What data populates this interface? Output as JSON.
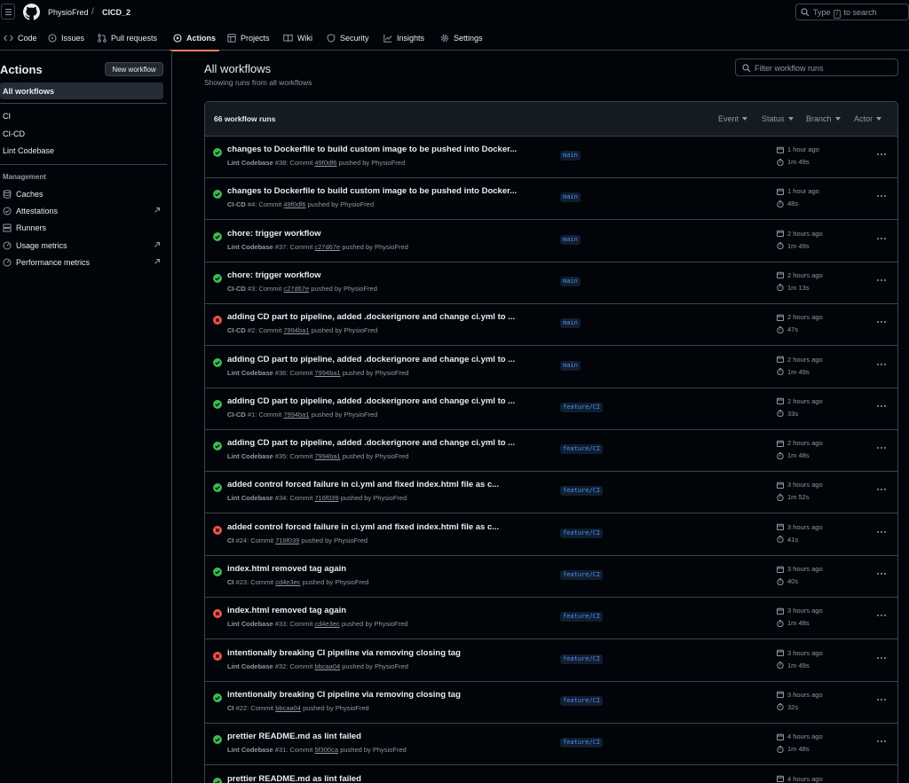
{
  "header": {
    "owner": "PhysioFred",
    "separator": "/",
    "repo": "CICD_2",
    "search": {
      "prefix": "Type",
      "key": "/",
      "suffix": "to search"
    }
  },
  "tabs": [
    {
      "label": "Code",
      "icon": "code-icon",
      "active": false
    },
    {
      "label": "Issues",
      "icon": "issue-icon",
      "active": false
    },
    {
      "label": "Pull requests",
      "icon": "pull-request-icon",
      "active": false
    },
    {
      "label": "Actions",
      "icon": "play-icon",
      "active": true
    },
    {
      "label": "Projects",
      "icon": "table-icon",
      "active": false
    },
    {
      "label": "Wiki",
      "icon": "book-icon",
      "active": false
    },
    {
      "label": "Security",
      "icon": "shield-icon",
      "active": false
    },
    {
      "label": "Insights",
      "icon": "graph-icon",
      "active": false
    },
    {
      "label": "Settings",
      "icon": "gear-icon",
      "active": false
    }
  ],
  "sidebar": {
    "title": "Actions",
    "new_workflow": "New workflow",
    "all_workflows": "All workflows",
    "workflows": [
      "CI",
      "CI-CD",
      "Lint Codebase"
    ],
    "management_heading": "Management",
    "management": [
      {
        "label": "Caches",
        "icon": "database-icon",
        "external": false
      },
      {
        "label": "Attestations",
        "icon": "verified-icon",
        "external": true
      },
      {
        "label": "Runners",
        "icon": "server-icon",
        "external": false
      },
      {
        "label": "Usage metrics",
        "icon": "meter-icon",
        "external": true
      },
      {
        "label": "Performance metrics",
        "icon": "meter-icon",
        "external": true
      }
    ]
  },
  "main": {
    "title": "All workflows",
    "subtitle": "Showing runs from all workflows",
    "filter_placeholder": "Filter workflow runs",
    "runs_count": "66 workflow runs",
    "filters": [
      "Event",
      "Status",
      "Branch",
      "Actor"
    ]
  },
  "runs": [
    {
      "status": "success",
      "title": "changes to Dockerfile to build custom image to be pushed into Docker...",
      "workflow": "Lint Codebase",
      "run": "#38",
      "verb": ": Commit",
      "commit": "49f0df6",
      "pushed_by": "pushed by PhysioFred",
      "branch": "main",
      "when": "1 hour ago",
      "duration": "1m 49s"
    },
    {
      "status": "success",
      "title": "changes to Dockerfile to build custom image to be pushed into Docker...",
      "workflow": "CI-CD",
      "run": "#4",
      "verb": ": Commit",
      "commit": "49f0df6",
      "pushed_by": "pushed by PhysioFred",
      "branch": "main",
      "when": "1 hour ago",
      "duration": "48s"
    },
    {
      "status": "success",
      "title": "chore: trigger workflow",
      "workflow": "Lint Codebase",
      "run": "#37",
      "verb": ": Commit",
      "commit": "c27d67e",
      "pushed_by": "pushed by PhysioFred",
      "branch": "main",
      "when": "2 hours ago",
      "duration": "1m 49s"
    },
    {
      "status": "success",
      "title": "chore: trigger workflow",
      "workflow": "CI-CD",
      "run": "#3",
      "verb": ": Commit",
      "commit": "c27d67e",
      "pushed_by": "pushed by PhysioFred",
      "branch": "main",
      "when": "2 hours ago",
      "duration": "1m 13s"
    },
    {
      "status": "failure",
      "title": "adding CD part to pipeline, added .dockerignore and change ci.yml to ...",
      "workflow": "CI-CD",
      "run": "#2",
      "verb": ": Commit",
      "commit": "7994ba1",
      "pushed_by": "pushed by PhysioFred",
      "branch": "main",
      "when": "2 hours ago",
      "duration": "47s"
    },
    {
      "status": "success",
      "title": "adding CD part to pipeline, added .dockerignore and change ci.yml to ...",
      "workflow": "Lint Codebase",
      "run": "#36",
      "verb": ": Commit",
      "commit": "7994ba1",
      "pushed_by": "pushed by PhysioFred",
      "branch": "main",
      "when": "2 hours ago",
      "duration": "1m 49s"
    },
    {
      "status": "success",
      "title": "adding CD part to pipeline, added .dockerignore and change ci.yml to ...",
      "workflow": "CI-CD",
      "run": "#1",
      "verb": ": Commit",
      "commit": "7994ba1",
      "pushed_by": "pushed by PhysioFred",
      "branch": "feature/CI",
      "when": "2 hours ago",
      "duration": "33s"
    },
    {
      "status": "success",
      "title": "adding CD part to pipeline, added .dockerignore and change ci.yml to ...",
      "workflow": "Lint Codebase",
      "run": "#35",
      "verb": ": Commit",
      "commit": "7994ba1",
      "pushed_by": "pushed by PhysioFred",
      "branch": "feature/CI",
      "when": "2 hours ago",
      "duration": "1m 48s"
    },
    {
      "status": "success",
      "title": "added control forced failure in ci.yml and fixed index.html file as c...",
      "workflow": "Lint Codebase",
      "run": "#34",
      "verb": ": Commit",
      "commit": "716f039",
      "pushed_by": "pushed by PhysioFred",
      "branch": "feature/CI",
      "when": "3 hours ago",
      "duration": "1m 52s"
    },
    {
      "status": "failure",
      "title": "added control forced failure in ci.yml and fixed index.html file as c...",
      "workflow": "CI",
      "run": "#24",
      "verb": ": Commit",
      "commit": "716f039",
      "pushed_by": "pushed by PhysioFred",
      "branch": "feature/CI",
      "when": "3 hours ago",
      "duration": "41s"
    },
    {
      "status": "success",
      "title": "index.html removed tag again",
      "workflow": "CI",
      "run": "#23",
      "verb": ": Commit",
      "commit": "cd4e3ec",
      "pushed_by": "pushed by PhysioFred",
      "branch": "feature/CI",
      "when": "3 hours ago",
      "duration": "40s"
    },
    {
      "status": "failure",
      "title": "index.html removed tag again",
      "workflow": "Lint Codebase",
      "run": "#33",
      "verb": ": Commit",
      "commit": "cd4e3ec",
      "pushed_by": "pushed by PhysioFred",
      "branch": "feature/CI",
      "when": "3 hours ago",
      "duration": "1m 48s"
    },
    {
      "status": "failure",
      "title": "intentionally breaking CI pipeline via removing closing tag",
      "workflow": "Lint Codebase",
      "run": "#32",
      "verb": ": Commit",
      "commit": "bbcaa04",
      "pushed_by": "pushed by PhysioFred",
      "branch": "feature/CI",
      "when": "3 hours ago",
      "duration": "1m 49s"
    },
    {
      "status": "success",
      "title": "intentionally breaking CI pipeline via removing closing tag",
      "workflow": "CI",
      "run": "#22",
      "verb": ": Commit",
      "commit": "bbcaa04",
      "pushed_by": "pushed by PhysioFred",
      "branch": "feature/CI",
      "when": "3 hours ago",
      "duration": "32s"
    },
    {
      "status": "success",
      "title": "prettier README.md as lint failed",
      "workflow": "Lint Codebase",
      "run": "#31",
      "verb": ": Commit",
      "commit": "5f300ca",
      "pushed_by": "pushed by PhysioFred",
      "branch": "feature/CI",
      "when": "4 hours ago",
      "duration": "1m 48s"
    },
    {
      "status": "success",
      "title": "prettier README.md as lint failed",
      "workflow": "",
      "run": "",
      "verb": "",
      "commit": "",
      "pushed_by": "",
      "branch": "",
      "when": "4 hours ago",
      "duration": ""
    }
  ],
  "colors": {
    "success": "#3fb950",
    "failure": "#f85149",
    "accent": "#f78166",
    "branch": "#4493f8"
  }
}
